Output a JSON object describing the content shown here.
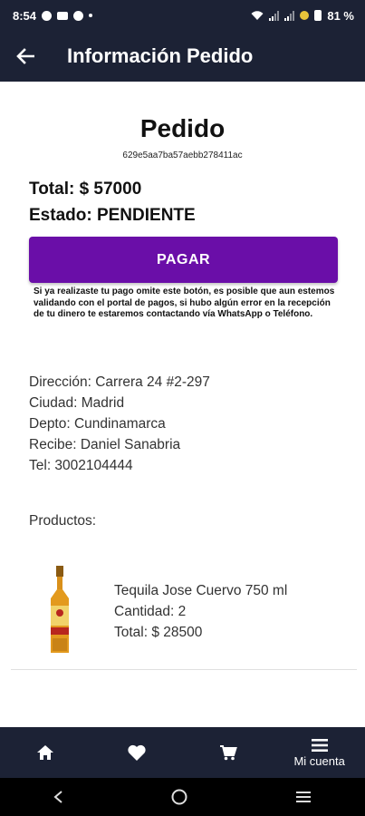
{
  "status_bar": {
    "time": "8:54",
    "battery": "81 %"
  },
  "app_bar": {
    "title": "Información Pedido",
    "back_icon": "arrow-left-icon"
  },
  "order": {
    "heading": "Pedido",
    "id": "629e5aa7ba57aebb278411ac",
    "total": "Total: $ 57000",
    "status": "Estado: PENDIENTE",
    "pay_button": "PAGAR",
    "pay_note": "Si ya realizaste tu pago omite este botón, es posible que aun estemos validando con el portal de pagos, si hubo algún error en la recepción de tu dinero te estaremos contactando vía WhatsApp o Teléfono."
  },
  "shipping": {
    "address": "Dirección: Carrera 24 #2-297",
    "city": "Ciudad: Madrid",
    "department": "Depto: Cundinamarca",
    "receiver": "Recibe: Daniel Sanabria",
    "phone": "Tel: 3002104444"
  },
  "products": {
    "label": "Productos:",
    "items": [
      {
        "name": "Tequila Jose Cuervo 750 ml",
        "quantity": "Cantidad: 2",
        "total": "Total: $ 28500"
      }
    ]
  },
  "bottom_nav": {
    "items": [
      {
        "icon": "home-icon",
        "label": ""
      },
      {
        "icon": "heart-icon",
        "label": ""
      },
      {
        "icon": "cart-icon",
        "label": ""
      },
      {
        "icon": "menu-icon",
        "label": "Mi cuenta"
      }
    ]
  },
  "colors": {
    "bar_bg": "#1c2235",
    "accent": "#6a0ea8"
  }
}
